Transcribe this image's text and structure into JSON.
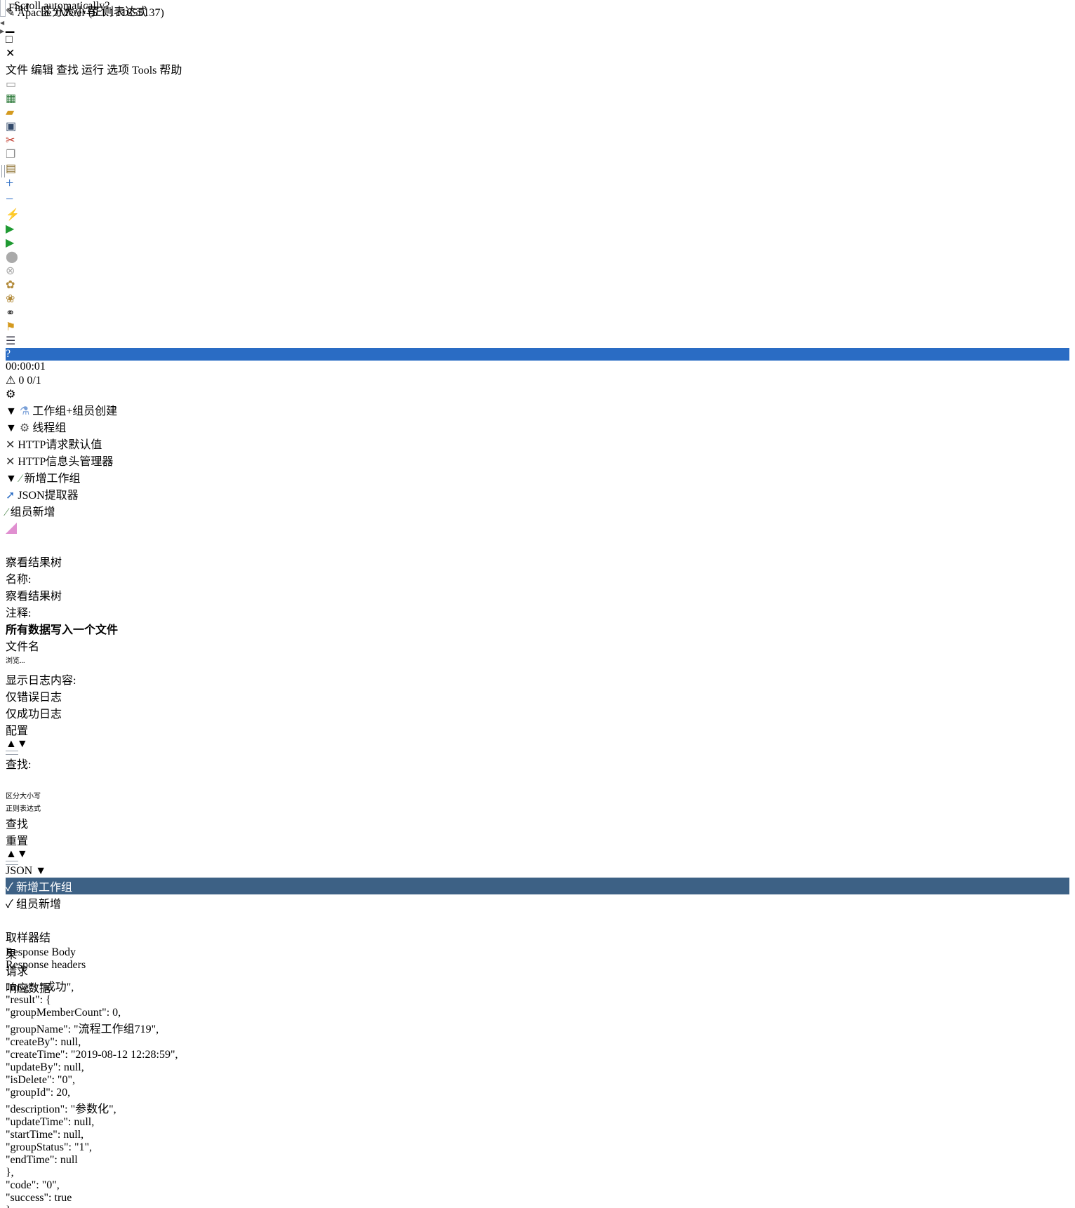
{
  "window": {
    "title": "Apache JMeter (5.1.1 r1855137)"
  },
  "menu": [
    "文件",
    "编辑",
    "查找",
    "运行",
    "选项",
    "Tools",
    "帮助"
  ],
  "toolbar": {
    "timer": "00:00:01",
    "warnings": "0",
    "threads": "0/1"
  },
  "tree": {
    "items": [
      {
        "label": "工作组+组员创建"
      },
      {
        "label": "线程组"
      },
      {
        "label": "HTTP请求默认值"
      },
      {
        "label": "HTTP信息头管理器"
      },
      {
        "label": "新增工作组"
      },
      {
        "label": "JSON提取器"
      },
      {
        "label": "组员新增"
      },
      {
        "label": "察看结果树"
      }
    ]
  },
  "panel": {
    "heading": "察看结果树",
    "name_label": "名称:",
    "name_value": "察看结果树",
    "comment_label": "注释:",
    "comment_value": "",
    "file_group_title": "所有数据写入一个文件",
    "filename_label": "文件名",
    "filename_value": "",
    "browse_button": "浏览...",
    "log_label": "显示日志内容:",
    "errors_only": "仅错误日志",
    "success_only": "仅成功日志",
    "configure_button": "配置",
    "search_label": "查找:",
    "search_value": "",
    "case_sensitive": "区分大小写",
    "regex": "正则表达式",
    "search_button": "查找",
    "reset_button": "重置"
  },
  "results": {
    "renderer": "JSON",
    "items": [
      {
        "label": "新增工作组"
      },
      {
        "label": "组员新增"
      }
    ],
    "scroll_auto": "Scroll automatically?"
  },
  "tabs": {
    "main": [
      "取样器结果",
      "请求",
      "响应数据"
    ],
    "sub": [
      "Response Body",
      "Response headers"
    ]
  },
  "find": {
    "label": "Find",
    "case_sensitive": "区分大小写",
    "regex": "正则表达式"
  },
  "response_lines": [
    "{",
    "   \"msg\": \"成功\",",
    "   \"result\": {",
    "      \"groupMemberCount\": 0,",
    "      \"groupName\": \"流程工作组719\",",
    "      \"createBy\": null,",
    "      \"createTime\": \"2019-08-12 12:28:59\",",
    "      \"updateBy\": null,",
    "      \"isDelete\": \"0\",",
    "      \"groupId\": 20,",
    "      \"description\": \"参数化\",",
    "      \"updateTime\": null,",
    "      \"startTime\": null,",
    "      \"groupStatus\": \"1\",",
    "      \"endTime\": null",
    "   },",
    "   \"code\": \"0\",",
    "   \"success\": true",
    "}"
  ]
}
